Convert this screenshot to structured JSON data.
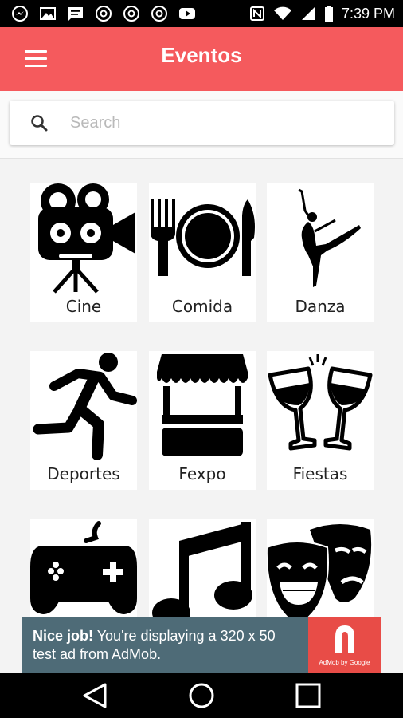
{
  "status_bar": {
    "time": "7:39 PM",
    "notification_icons": [
      "messenger-icon",
      "image-icon",
      "message-icon",
      "chrome-icon",
      "chrome-icon",
      "chrome-icon",
      "youtube-icon"
    ],
    "system_icons": [
      "nfc-icon",
      "wifi-icon",
      "signal-icon",
      "battery-icon"
    ]
  },
  "app_bar": {
    "title": "Eventos",
    "color": "#f55a5d"
  },
  "search": {
    "placeholder": "Search",
    "value": ""
  },
  "categories": [
    {
      "label": "Cine",
      "icon": "movie-camera-icon"
    },
    {
      "label": "Comida",
      "icon": "dinner-plate-icon"
    },
    {
      "label": "Danza",
      "icon": "ballerina-icon"
    },
    {
      "label": "Deportes",
      "icon": "runner-icon"
    },
    {
      "label": "Fexpo",
      "icon": "market-stand-icon"
    },
    {
      "label": "Fiestas",
      "icon": "wine-glasses-icon"
    },
    {
      "label": "",
      "icon": "game-controller-icon"
    },
    {
      "label": "",
      "icon": "music-note-icon"
    },
    {
      "label": "",
      "icon": "theater-masks-icon"
    }
  ],
  "ad_banner": {
    "bold": "Nice job!",
    "text": " You're displaying a 320 x 50 test ad from AdMob.",
    "brand": "AdMob by Google",
    "background": "#4e6b77",
    "logo_color": "#e84c47"
  },
  "nav_bar": {
    "buttons": [
      "back-icon",
      "home-icon",
      "recents-icon"
    ]
  }
}
